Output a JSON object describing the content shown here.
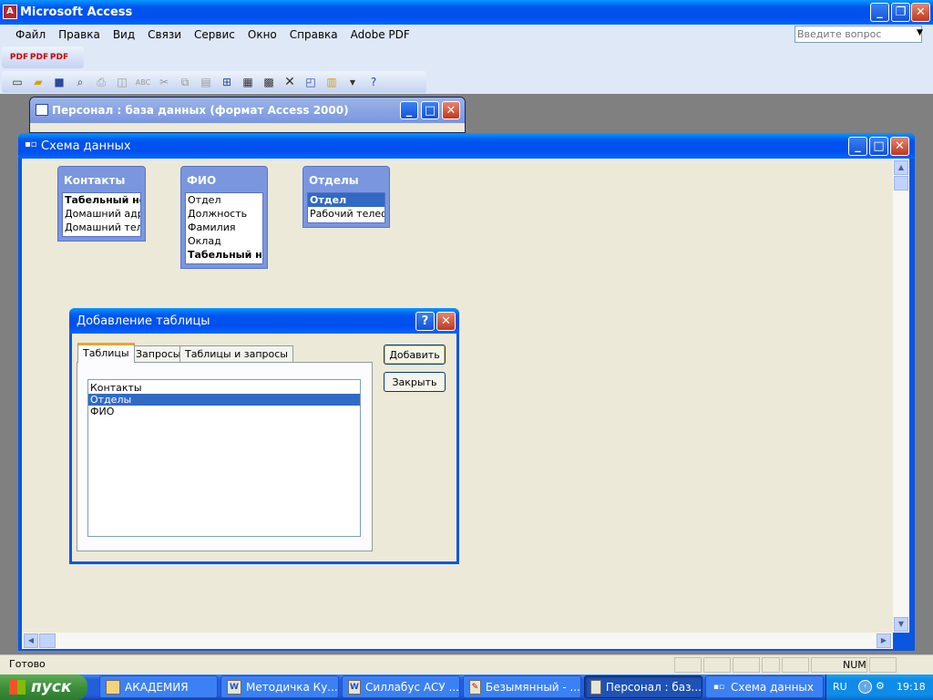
{
  "app": {
    "title": "Microsoft Access"
  },
  "menu": [
    "Файл",
    "Правка",
    "Вид",
    "Связи",
    "Сервис",
    "Окно",
    "Справка",
    "Adobe PDF"
  ],
  "search": {
    "placeholder": "Введите вопрос"
  },
  "db_window": {
    "title": "Персонал : база данных (формат Access 2000)"
  },
  "schema_window": {
    "title": "Схема данных",
    "tables": [
      {
        "name": "Контакты",
        "fields": [
          {
            "text": "Табельный номе",
            "key": true
          },
          {
            "text": "Домашний адрес",
            "key": false
          },
          {
            "text": "Домашний телес",
            "key": false
          }
        ]
      },
      {
        "name": "ФИО",
        "fields": [
          {
            "text": "Отдел",
            "key": false
          },
          {
            "text": "Должность",
            "key": false
          },
          {
            "text": "Фамилия",
            "key": false
          },
          {
            "text": "Оклад",
            "key": false
          },
          {
            "text": "Табельный номе",
            "key": true
          }
        ]
      },
      {
        "name": "Отделы",
        "fields": [
          {
            "text": "Отдел",
            "key": true,
            "selected": true
          },
          {
            "text": "Рабочий телефо",
            "key": false
          }
        ]
      }
    ]
  },
  "dialog": {
    "title": "Добавление таблицы",
    "help_label": "?",
    "tabs": [
      "Таблицы",
      "Запросы",
      "Таблицы и запросы"
    ],
    "active_tab": 0,
    "list": [
      "Контакты",
      "Отделы",
      "ФИО"
    ],
    "selected_index": 1,
    "add_label": "Добавить",
    "close_label": "Закрыть"
  },
  "status": {
    "text": "Готово",
    "num": "NUM"
  },
  "taskbar": {
    "start_label": "пуск",
    "items": [
      {
        "label": "АКАДЕМИЯ",
        "icon": "folder-icon"
      },
      {
        "label": "Методичка Ку...",
        "icon": "word-icon"
      },
      {
        "label": "Силлабус АСУ ...",
        "icon": "word-icon"
      },
      {
        "label": "Безымянный - ...",
        "icon": "paint-icon"
      },
      {
        "label": "Персонал : баз...",
        "icon": "access-icon"
      },
      {
        "label": "Схема данных",
        "icon": "schema-icon"
      }
    ],
    "lang": "RU",
    "clock": "19:18"
  },
  "colors": {
    "xp_blue": "#0a56e0",
    "selection": "#316ac5",
    "table_header": "#7a96df"
  }
}
